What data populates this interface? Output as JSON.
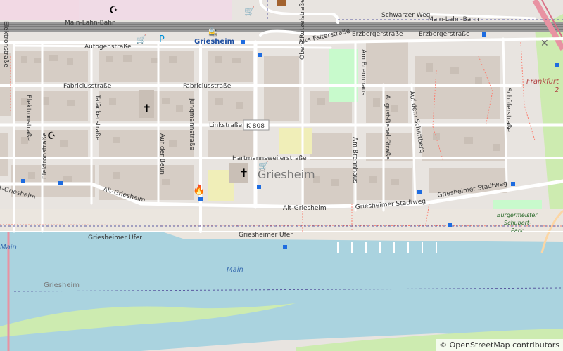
{
  "colors": {
    "river": "#aad3df",
    "land": "#e8e4e0",
    "block": "#d9d0c9",
    "park": "#c8facc",
    "grass": "#cdebb0",
    "school": "#f0eeb8",
    "rail": "#8a8a8a"
  },
  "labels": {
    "train_station_top": "Main-Lahn-Bahn",
    "train_station_right": "Main-Lahn-Bahn",
    "schwarzer_weg": "Schwarzer Weg",
    "autogen": "Autogenstraße",
    "alte_falter": "Alte Falterstraße",
    "erzberger_left": "Erzbergerstraße",
    "erzberger_right": "Erzbergerstraße",
    "station_name": "Griesheim",
    "elektron_top": "Elektronstraße",
    "fabricius_left": "Fabriciusstraße",
    "fabricius_mid": "Fabriciusstraße",
    "taescke": "Taläckerstraße",
    "elektron_mid": "Elektronstraße",
    "link_left": "Linkstraße",
    "link_k808": "K 808",
    "jungmann": "Jungmannstraße",
    "auf_der_beun": "Auf der Beun",
    "obere_rutz": "Obere Rutzelstraße",
    "am_brennhaus_top": "Am Brennhaus",
    "am_brennhaus_bot": "Am Brennhaus",
    "august_bebel": "August-Bebel-Straße",
    "auf_dem_schaftberg": "Auf dem Schaftberg",
    "schoefer": "Schöferstraße",
    "hartmannsweiler": "Hartmannsweilerstraße",
    "griesheim_district": "Griesheim",
    "elektron_bot": "Elektronstraße",
    "alt_griesheim_left": "Alt-Griesheim",
    "alt_griesheim_mid": "Alt-Griesheim",
    "stadtweg_mid": "Griesheimer Stadtweg",
    "stadtweg_right": "Griesheimer Stadtweg",
    "ufer_left": "Griesheimer Ufer",
    "ufer_mid": "Griesheimer Ufer",
    "main_left": "Main",
    "main_mid": "Main",
    "griesheim_river": "Griesheim",
    "frankfurt": "Frankfurt",
    "park": "Burgermeister-Schubert-Park",
    "park_l1": "Burgermeister",
    "park_l2": "Schubert-",
    "park_l3": "Park",
    "frankfurt_num": "2"
  },
  "attribution": {
    "symbol": "©",
    "link": "OpenStreetMap",
    "suffix": "contributors"
  }
}
